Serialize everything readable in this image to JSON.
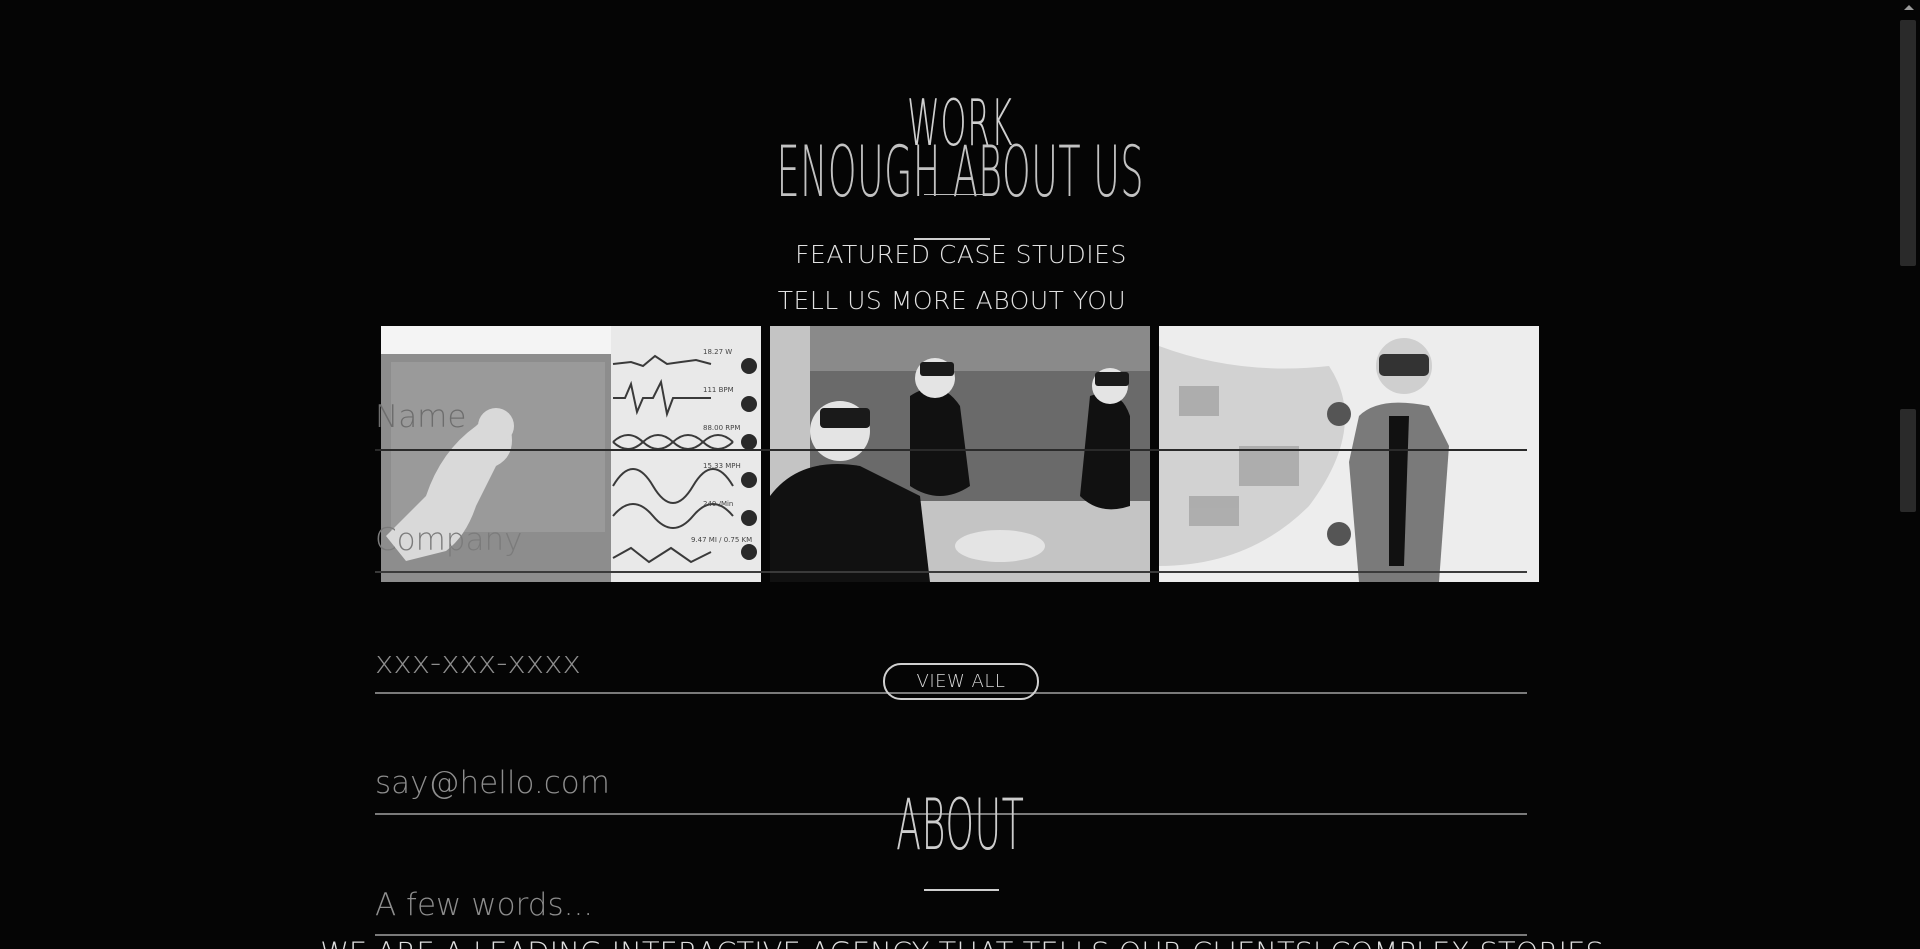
{
  "sections": {
    "work_heading": "WORK",
    "enough_heading": "ENOUGH ABOUT US",
    "featured_label": "FEATURED CASE STUDIES",
    "tellus_label": "TELL US MORE ABOUT YOU",
    "view_all_label": "VIEW ALL",
    "about_heading": "ABOUT",
    "about_text": "WE ARE A LEADING INTERACTIVE AGENCY THAT TELLS OUR CLIENTS' COMPLEX STORIES"
  },
  "case_studies": [
    {
      "title": "cycling-metrics-case-study"
    },
    {
      "title": "vr-demo-group-case-study"
    },
    {
      "title": "vr-presenter-case-study"
    }
  ],
  "tile1_metrics": [
    "18.27 W",
    "111 BPM",
    "88.00 RPM",
    "15.33 MPH",
    "240 /Min",
    "9.47 MI / 0.75 KM"
  ],
  "form": {
    "name_placeholder": "Name",
    "company_placeholder": "Company",
    "phone_placeholder": "xxx-xxx-xxxx",
    "email_placeholder": "say@hello.com",
    "words_placeholder": "A few words..."
  },
  "colors": {
    "background": "#050505",
    "text": "#d8d8d8",
    "rule": "#cfcfcf"
  },
  "icons": {
    "scroll_up": "scroll-up-arrow-icon"
  }
}
